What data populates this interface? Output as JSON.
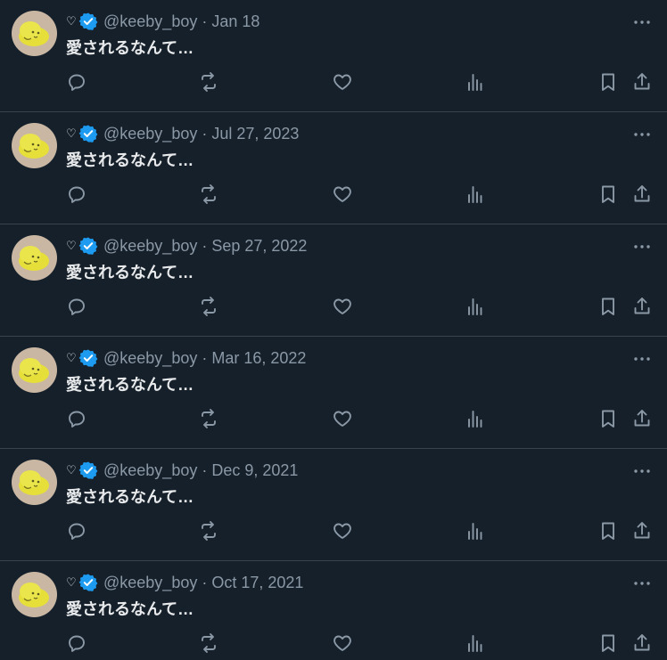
{
  "colors": {
    "background": "#15202b",
    "text_primary": "#e7e9ea",
    "text_secondary": "#8b98a5",
    "verified_badge": "#1d9bf0",
    "divider": "#38444d"
  },
  "icons": {
    "name_heart": "♡",
    "verified": "verified-badge-icon",
    "more": "more-icon",
    "reply": "reply-icon",
    "retweet": "retweet-icon",
    "like": "like-icon",
    "views": "views-icon",
    "bookmark": "bookmark-icon",
    "share": "share-icon"
  },
  "tweets": [
    {
      "handle": "@keeby_boy",
      "date": "Jan 18",
      "text": "愛されるなんて…"
    },
    {
      "handle": "@keeby_boy",
      "date": "Jul 27, 2023",
      "text": "愛されるなんて…"
    },
    {
      "handle": "@keeby_boy",
      "date": "Sep 27, 2022",
      "text": "愛されるなんて…"
    },
    {
      "handle": "@keeby_boy",
      "date": "Mar 16, 2022",
      "text": "愛されるなんて…"
    },
    {
      "handle": "@keeby_boy",
      "date": "Dec 9, 2021",
      "text": "愛されるなんて…"
    },
    {
      "handle": "@keeby_boy",
      "date": "Oct 17, 2021",
      "text": "愛されるなんて…"
    }
  ]
}
